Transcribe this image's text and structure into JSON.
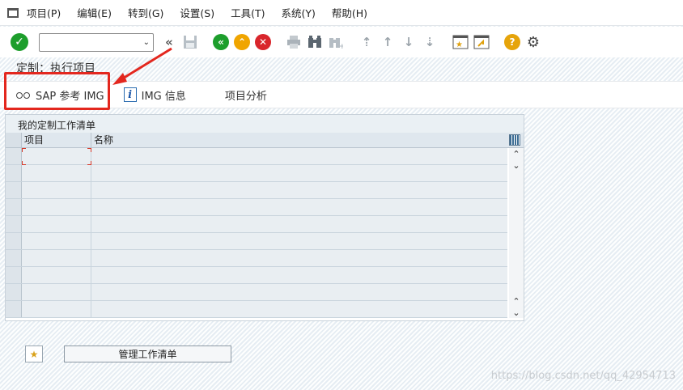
{
  "menubar": {
    "items": [
      "项目(P)",
      "编辑(E)",
      "转到(G)",
      "设置(S)",
      "工具(T)",
      "系统(Y)",
      "帮助(H)"
    ]
  },
  "toolbar": {
    "command_field_value": ""
  },
  "page": {
    "title": "定制：执行项目"
  },
  "appbar": {
    "sap_ref_img": "SAP 参考 IMG",
    "img_info": "IMG 信息",
    "project_analysis": "项目分析"
  },
  "worklist": {
    "title": "我的定制工作清单",
    "columns": [
      "项目",
      "名称"
    ],
    "rows": [
      {
        "item": "",
        "name": ""
      },
      {
        "item": "",
        "name": ""
      },
      {
        "item": "",
        "name": ""
      },
      {
        "item": "",
        "name": ""
      },
      {
        "item": "",
        "name": ""
      },
      {
        "item": "",
        "name": ""
      },
      {
        "item": "",
        "name": ""
      },
      {
        "item": "",
        "name": ""
      },
      {
        "item": "",
        "name": ""
      },
      {
        "item": "",
        "name": ""
      }
    ]
  },
  "buttons": {
    "manage_worklist": "管理工作清单"
  },
  "watermark": "https://blog.csdn.net/qq_42954713",
  "colors": {
    "highlight": "#e3271e",
    "ok_green": "#1d9e2c",
    "back_green": "#1d9e2c",
    "exit_yellow": "#f0a500",
    "cancel_red": "#d9262c"
  }
}
